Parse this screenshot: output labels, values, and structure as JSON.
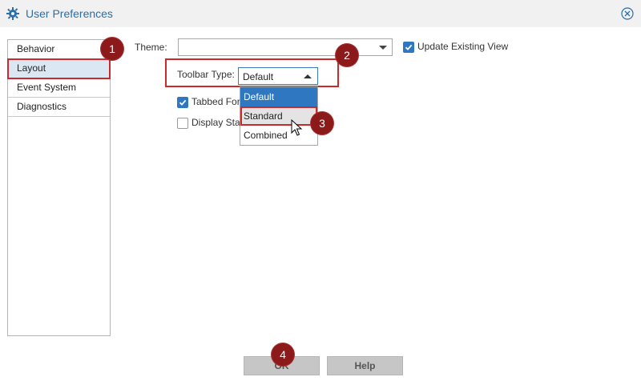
{
  "window": {
    "title": "User Preferences",
    "accent_color": "#2c6ea8",
    "icons": {
      "title": "gear-icon",
      "close": "close-circle-icon"
    }
  },
  "sidebar": {
    "items": [
      {
        "label": "Behavior"
      },
      {
        "label": "Layout"
      },
      {
        "label": "Event System"
      },
      {
        "label": "Diagnostics"
      }
    ],
    "selected": "Layout"
  },
  "main": {
    "theme_label": "Theme:",
    "theme_value": "",
    "update_existing_view": {
      "label": "Update Existing View",
      "checked": true
    },
    "toolbar_type": {
      "label": "Toolbar Type:",
      "value": "Default",
      "options": [
        "Default",
        "Standard",
        "Combined"
      ],
      "highlighted_option": "Standard"
    },
    "tabbed_checkbox": {
      "label": "Tabbed For",
      "checked": true
    },
    "display_checkbox": {
      "label": "Display Sta",
      "checked": false
    }
  },
  "buttons": {
    "ok": "OK",
    "help": "Help"
  },
  "annotations": {
    "badges": [
      "1",
      "2",
      "3",
      "4"
    ],
    "badge_color": "#8c1a1a",
    "highlight_color": "#cc2a2a"
  }
}
